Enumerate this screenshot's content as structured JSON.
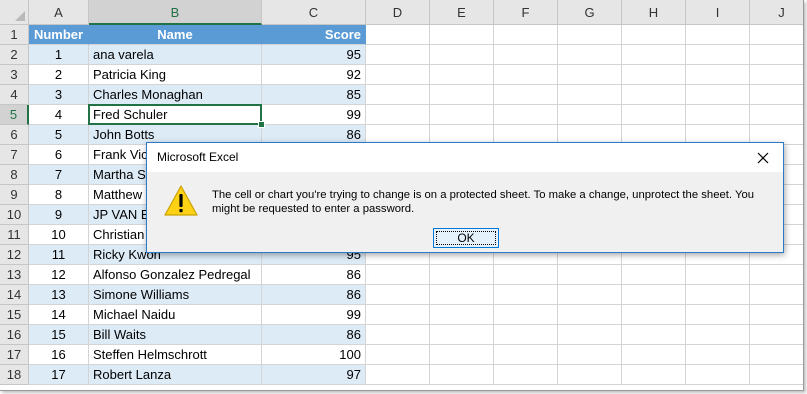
{
  "sheet": {
    "columns": [
      "A",
      "B",
      "C",
      "D",
      "E",
      "F",
      "G",
      "H",
      "I",
      "J"
    ],
    "row_numbers": [
      "1",
      "2",
      "3",
      "4",
      "5",
      "6",
      "7",
      "8",
      "9",
      "10",
      "11",
      "12",
      "13",
      "14",
      "15",
      "16",
      "17",
      "18"
    ],
    "headers": [
      "Number",
      "Name",
      "Score"
    ],
    "rows": [
      {
        "number": "1",
        "name": "ana varela",
        "score": "95"
      },
      {
        "number": "2",
        "name": "Patricia King",
        "score": "92"
      },
      {
        "number": "3",
        "name": "Charles Monaghan",
        "score": "85"
      },
      {
        "number": "4",
        "name": "Fred Schuler",
        "score": "99"
      },
      {
        "number": "5",
        "name": "John Botts",
        "score": "86"
      },
      {
        "number": "6",
        "name": "Frank Vic",
        "score": ""
      },
      {
        "number": "7",
        "name": "Martha S",
        "score": ""
      },
      {
        "number": "8",
        "name": "Matthew",
        "score": ""
      },
      {
        "number": "9",
        "name": "JP VAN B",
        "score": ""
      },
      {
        "number": "10",
        "name": "Christian",
        "score": ""
      },
      {
        "number": "11",
        "name": "Ricky Kwon",
        "score": "95"
      },
      {
        "number": "12",
        "name": "Alfonso Gonzalez Pedregal",
        "score": "86"
      },
      {
        "number": "13",
        "name": "Simone Williams",
        "score": "86"
      },
      {
        "number": "14",
        "name": "Michael Naidu",
        "score": "99"
      },
      {
        "number": "15",
        "name": "Bill Waits",
        "score": "86"
      },
      {
        "number": "16",
        "name": "Steffen Helmschrott",
        "score": "100"
      },
      {
        "number": "17",
        "name": "Robert Lanza",
        "score": "97"
      }
    ],
    "colors": {
      "header_fill": "#5b9bd5",
      "band_fill": "#ddebf7",
      "selection": "#217346"
    }
  },
  "dialog": {
    "title": "Microsoft Excel",
    "message": "The cell or chart you're trying to change is on a protected sheet. To make a change, unprotect the sheet. You might be requested to enter a password.",
    "ok_label": "OK",
    "icon": "warning-icon",
    "close_icon": "close-icon"
  }
}
